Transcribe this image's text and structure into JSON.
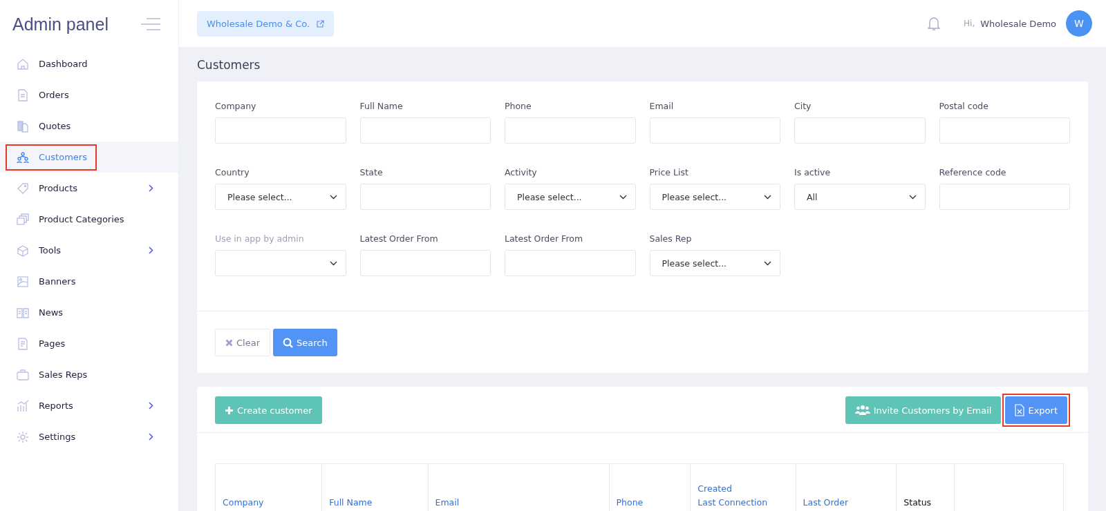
{
  "sidebar": {
    "title": "Admin panel",
    "items": [
      {
        "label": "Dashboard",
        "selected": false,
        "expandable": false,
        "highlighted": false
      },
      {
        "label": "Orders",
        "selected": false,
        "expandable": false,
        "highlighted": false
      },
      {
        "label": "Quotes",
        "selected": false,
        "expandable": false,
        "highlighted": false
      },
      {
        "label": "Customers",
        "selected": true,
        "expandable": false,
        "highlighted": true
      },
      {
        "label": "Products",
        "selected": false,
        "expandable": true,
        "highlighted": false
      },
      {
        "label": "Product Categories",
        "selected": false,
        "expandable": false,
        "highlighted": false
      },
      {
        "label": "Tools",
        "selected": false,
        "expandable": true,
        "highlighted": false
      },
      {
        "label": "Banners",
        "selected": false,
        "expandable": false,
        "highlighted": false
      },
      {
        "label": "News",
        "selected": false,
        "expandable": false,
        "highlighted": false
      },
      {
        "label": "Pages",
        "selected": false,
        "expandable": false,
        "highlighted": false
      },
      {
        "label": "Sales Reps",
        "selected": false,
        "expandable": false,
        "highlighted": false
      },
      {
        "label": "Reports",
        "selected": false,
        "expandable": true,
        "highlighted": false
      },
      {
        "label": "Settings",
        "selected": false,
        "expandable": true,
        "highlighted": false
      }
    ]
  },
  "header": {
    "store_button": "Wholesale Demo & Co.",
    "greeting": "Hi,",
    "user_name": "Wholesale Demo",
    "avatar_initial": "W"
  },
  "page_title": "Customers",
  "filters": [
    {
      "label": "Company",
      "kind": "text",
      "disabled": false
    },
    {
      "label": "Full Name",
      "kind": "text",
      "disabled": false
    },
    {
      "label": "Phone",
      "kind": "text",
      "disabled": false
    },
    {
      "label": "Email",
      "kind": "text",
      "disabled": false
    },
    {
      "label": "City",
      "kind": "text",
      "disabled": false
    },
    {
      "label": "Postal code",
      "kind": "text",
      "disabled": false
    },
    {
      "label": "Country",
      "kind": "select",
      "value": "Please select...",
      "disabled": false
    },
    {
      "label": "State",
      "kind": "text",
      "disabled": false
    },
    {
      "label": "Activity",
      "kind": "select",
      "value": "Please select...",
      "disabled": false
    },
    {
      "label": "Price List",
      "kind": "select",
      "value": "Please select...",
      "disabled": false
    },
    {
      "label": "Is active",
      "kind": "select",
      "value": "All",
      "disabled": false
    },
    {
      "label": "Reference code",
      "kind": "text",
      "disabled": false
    },
    {
      "label": "Use in app by admin",
      "kind": "select",
      "disabled": true
    },
    {
      "label": "Latest Order From",
      "kind": "text",
      "disabled": false
    },
    {
      "label": "Latest Order From",
      "kind": "text",
      "disabled": false
    },
    {
      "label": "Sales Rep",
      "kind": "select",
      "value": "Please select...",
      "disabled": false
    }
  ],
  "filter_buttons": {
    "clear": "Clear",
    "search": "Search"
  },
  "actions": {
    "create": "Create customer",
    "invite": "Invite Customers by Email",
    "export": "Export",
    "export_highlighted": true
  },
  "table": {
    "columns": [
      {
        "lines": [
          "Company"
        ],
        "sortable": true
      },
      {
        "lines": [
          "Full Name"
        ],
        "sortable": true
      },
      {
        "lines": [
          "Email"
        ],
        "sortable": true
      },
      {
        "lines": [
          "Phone"
        ],
        "sortable": true
      },
      {
        "lines": [
          "Created",
          "Last Connection"
        ],
        "sortable": true
      },
      {
        "lines": [
          "Last Order"
        ],
        "sortable": true
      },
      {
        "lines": [
          "Status"
        ],
        "sortable": false
      }
    ]
  }
}
